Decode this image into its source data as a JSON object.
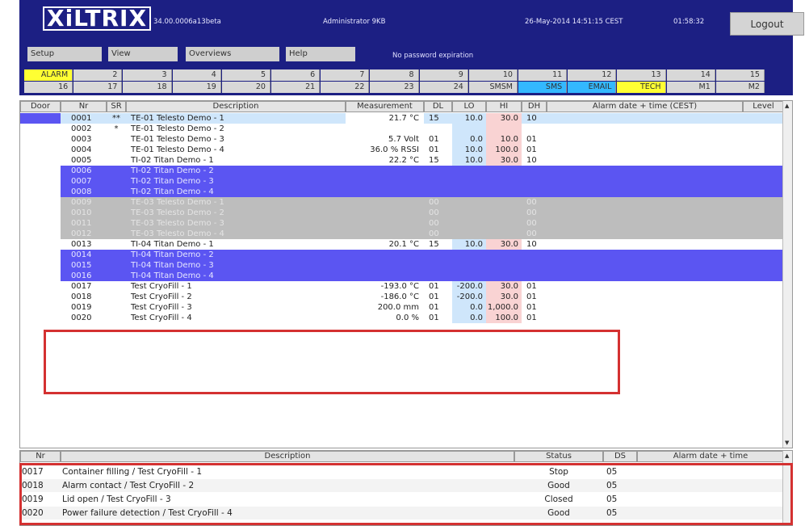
{
  "header": {
    "logo": "XiLTRIX",
    "version": "34.00.0006a13beta",
    "user": "Administrator 9KB",
    "datetime": "26-May-2014 14:51:15 CEST",
    "uptime": "01:58:32",
    "logout_label": "Logout"
  },
  "menu": {
    "items": [
      {
        "label": "Setup"
      },
      {
        "label": "View"
      },
      {
        "label": "Overviews"
      },
      {
        "label": "Help"
      }
    ],
    "password_notice": "No password expiration"
  },
  "tabs_row1": [
    {
      "label": "ALARM",
      "color": "#ffff33"
    },
    {
      "label": "2"
    },
    {
      "label": "3"
    },
    {
      "label": "4"
    },
    {
      "label": "5"
    },
    {
      "label": "6"
    },
    {
      "label": "7"
    },
    {
      "label": "8"
    },
    {
      "label": "9"
    },
    {
      "label": "10"
    },
    {
      "label": "11"
    },
    {
      "label": "12"
    },
    {
      "label": "13"
    },
    {
      "label": "14"
    },
    {
      "label": "15"
    }
  ],
  "tabs_row2": [
    {
      "label": "16"
    },
    {
      "label": "17"
    },
    {
      "label": "18"
    },
    {
      "label": "19"
    },
    {
      "label": "20"
    },
    {
      "label": "21"
    },
    {
      "label": "22"
    },
    {
      "label": "23"
    },
    {
      "label": "24"
    },
    {
      "label": "SMSM"
    },
    {
      "label": "SMS",
      "color": "#33b8ff"
    },
    {
      "label": "EMAIL",
      "color": "#33b8ff"
    },
    {
      "label": "TECH",
      "color": "#ffff33"
    },
    {
      "label": "M1"
    },
    {
      "label": "M2"
    }
  ],
  "main_table": {
    "columns": [
      "Door",
      "Nr",
      "SR",
      "Description",
      "Measurement",
      "DL",
      "LO",
      "HI",
      "DH",
      "Alarm date + time (CEST)",
      "Level"
    ],
    "rows": [
      {
        "state": "selected",
        "nr": "0001",
        "sr": "**",
        "desc": "TE-01 Telesto Demo - 1",
        "meas": "21.7 °C",
        "dl": "15",
        "lo": "10.0",
        "hi": "30.0",
        "dh": "10"
      },
      {
        "state": "normal",
        "nr": "0002",
        "sr": "*",
        "desc": "TE-01 Telesto Demo - 2",
        "meas": "",
        "dl": "",
        "lo": "",
        "hi": "",
        "dh": ""
      },
      {
        "state": "normal",
        "nr": "0003",
        "sr": "",
        "desc": "TE-01 Telesto Demo - 3",
        "meas": "5.7 Volt",
        "dl": "01",
        "lo": "0.0",
        "hi": "10.0",
        "dh": "01"
      },
      {
        "state": "normal",
        "nr": "0004",
        "sr": "",
        "desc": "TE-01 Telesto Demo - 4",
        "meas": "36.0 % RSSI",
        "dl": "01",
        "lo": "10.0",
        "hi": "100.0",
        "dh": "01"
      },
      {
        "state": "normal",
        "nr": "0005",
        "sr": "",
        "desc": "TI-02 Titan Demo - 1",
        "meas": "22.2 °C",
        "dl": "15",
        "lo": "10.0",
        "hi": "30.0",
        "dh": "10"
      },
      {
        "state": "blue",
        "nr": "0006",
        "sr": "",
        "desc": "TI-02 Titan Demo - 2",
        "meas": "",
        "dl": "",
        "lo": "",
        "hi": "",
        "dh": ""
      },
      {
        "state": "blue",
        "nr": "0007",
        "sr": "",
        "desc": "TI-02 Titan Demo - 3",
        "meas": "",
        "dl": "",
        "lo": "",
        "hi": "",
        "dh": ""
      },
      {
        "state": "blue",
        "nr": "0008",
        "sr": "",
        "desc": "TI-02 Titan Demo - 4",
        "meas": "",
        "dl": "",
        "lo": "",
        "hi": "",
        "dh": ""
      },
      {
        "state": "grey",
        "nr": "0009",
        "sr": "",
        "desc": "TE-03 Telesto Demo - 1",
        "meas": "",
        "dl": "00",
        "lo": "",
        "hi": "",
        "dh": "00"
      },
      {
        "state": "grey",
        "nr": "0010",
        "sr": "",
        "desc": "TE-03 Telesto Demo - 2",
        "meas": "",
        "dl": "00",
        "lo": "",
        "hi": "",
        "dh": "00"
      },
      {
        "state": "grey",
        "nr": "0011",
        "sr": "",
        "desc": "TE-03 Telesto Demo - 3",
        "meas": "",
        "dl": "00",
        "lo": "",
        "hi": "",
        "dh": "00"
      },
      {
        "state": "grey",
        "nr": "0012",
        "sr": "",
        "desc": "TE-03 Telesto Demo - 4",
        "meas": "",
        "dl": "00",
        "lo": "",
        "hi": "",
        "dh": "00"
      },
      {
        "state": "normal",
        "nr": "0013",
        "sr": "",
        "desc": "TI-04 Titan Demo - 1",
        "meas": "20.1 °C",
        "dl": "15",
        "lo": "10.0",
        "hi": "30.0",
        "dh": "10"
      },
      {
        "state": "blue",
        "nr": "0014",
        "sr": "",
        "desc": "TI-04 Titan Demo - 2",
        "meas": "",
        "dl": "",
        "lo": "",
        "hi": "",
        "dh": ""
      },
      {
        "state": "blue",
        "nr": "0015",
        "sr": "",
        "desc": "TI-04 Titan Demo - 3",
        "meas": "",
        "dl": "",
        "lo": "",
        "hi": "",
        "dh": ""
      },
      {
        "state": "blue",
        "nr": "0016",
        "sr": "",
        "desc": "TI-04 Titan Demo - 4",
        "meas": "",
        "dl": "",
        "lo": "",
        "hi": "",
        "dh": ""
      },
      {
        "state": "normal",
        "nr": "0017",
        "sr": "",
        "desc": "Test CryoFill - 1",
        "meas": "-193.0 °C",
        "dl": "01",
        "lo": "-200.0",
        "hi": "30.0",
        "dh": "01"
      },
      {
        "state": "normal",
        "nr": "0018",
        "sr": "",
        "desc": "Test CryoFill - 2",
        "meas": "-186.0 °C",
        "dl": "01",
        "lo": "-200.0",
        "hi": "30.0",
        "dh": "01"
      },
      {
        "state": "normal",
        "nr": "0019",
        "sr": "",
        "desc": "Test CryoFill - 3",
        "meas": "200.0 mm",
        "dl": "01",
        "lo": "0.0",
        "hi": "1,000.0",
        "dh": "01"
      },
      {
        "state": "normal",
        "nr": "0020",
        "sr": "",
        "desc": "Test CryoFill - 4",
        "meas": "0.0 %",
        "dl": "01",
        "lo": "0.0",
        "hi": "100.0",
        "dh": "01"
      }
    ]
  },
  "lower_table": {
    "columns": [
      "Nr",
      "Description",
      "Status",
      "DS",
      "Alarm date + time"
    ],
    "rows": [
      {
        "nr": "0017",
        "desc": "Container filling / Test CryoFill - 1",
        "status": "Stop",
        "ds": "05"
      },
      {
        "nr": "0018",
        "desc": "Alarm contact / Test CryoFill - 2",
        "status": "Good",
        "ds": "05"
      },
      {
        "nr": "0019",
        "desc": "Lid open / Test CryoFill - 3",
        "status": "Closed",
        "ds": "05"
      },
      {
        "nr": "0020",
        "desc": "Power failure detection / Test CryoFill - 4",
        "status": "Good",
        "ds": "05"
      }
    ]
  },
  "colors": {
    "header_bg": "#1c1f83",
    "row_blue": "#5b55f2",
    "row_grey": "#bdbdbd",
    "lo_cell": "#cfe6fb",
    "hi_cell": "#f9d3d3",
    "selected_row": "#cfe6fb",
    "door_selected": "#5b55f2",
    "highlight_box": "#d43131"
  }
}
